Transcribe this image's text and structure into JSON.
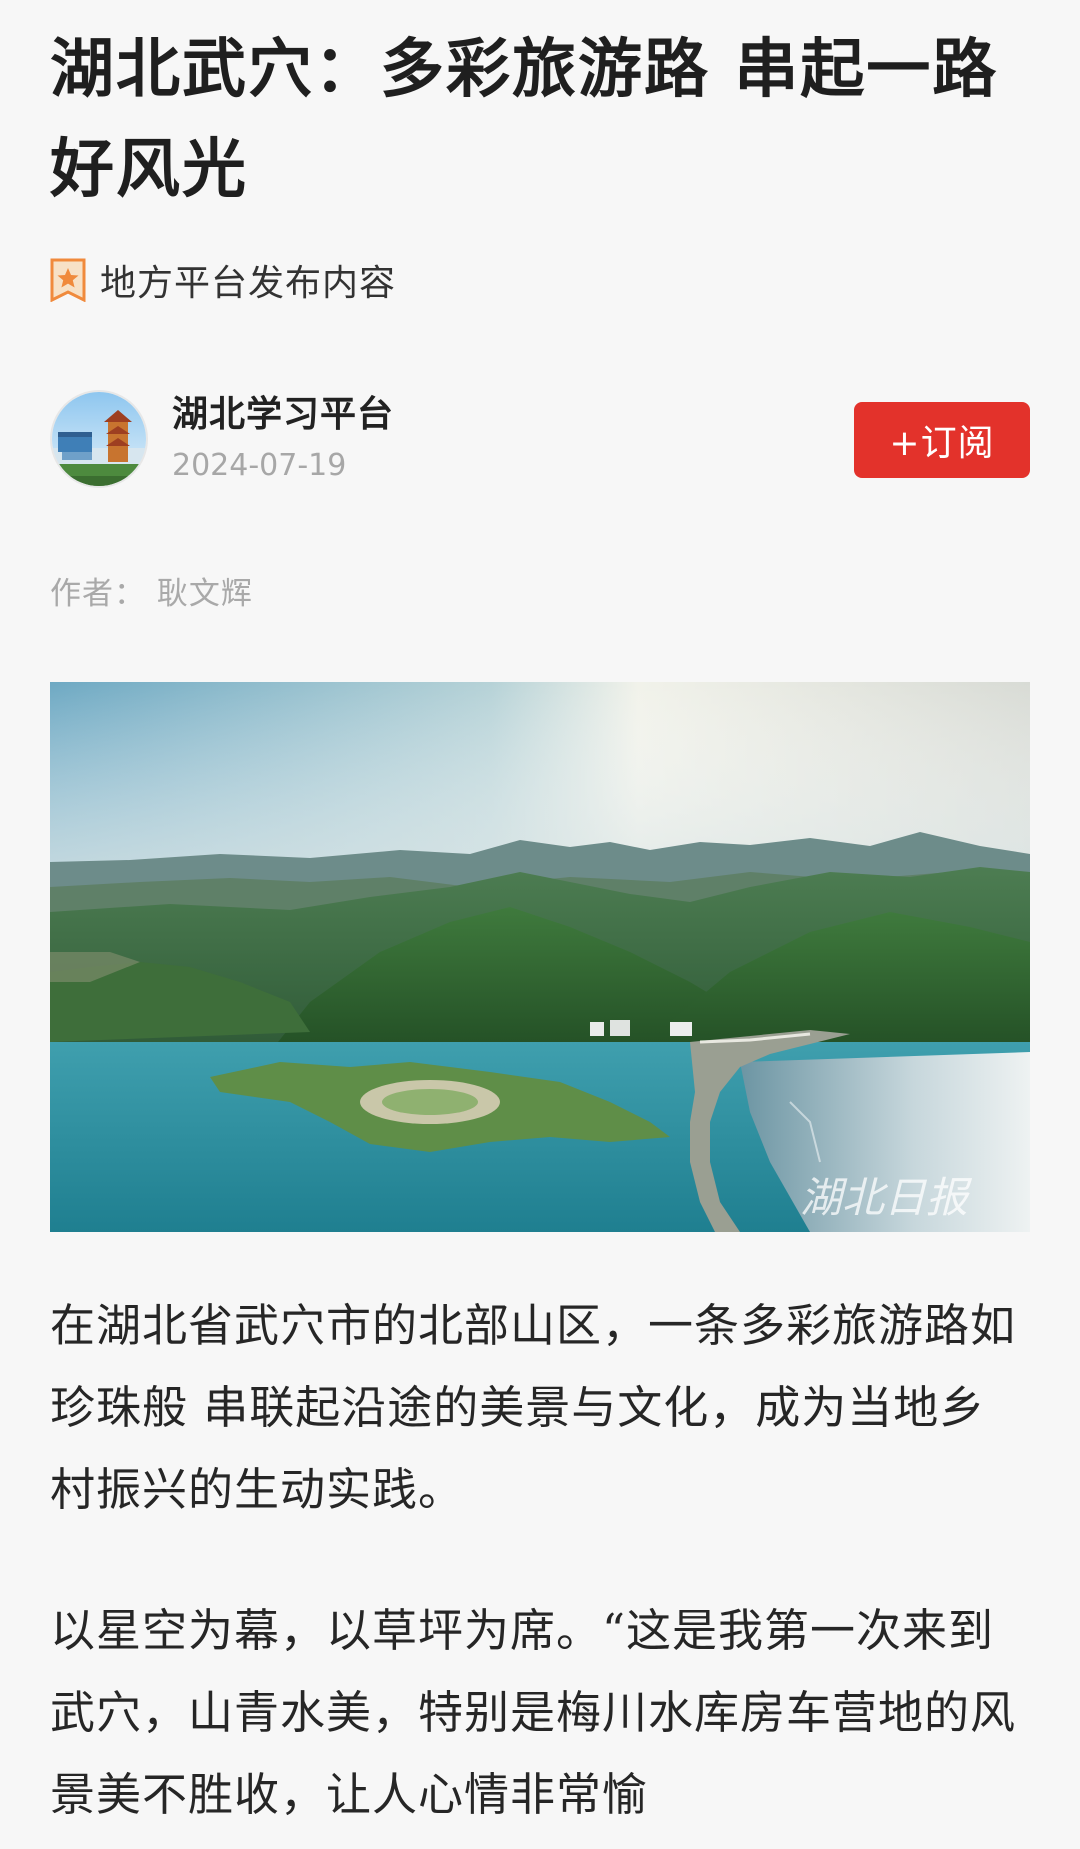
{
  "article": {
    "title": "湖北武穴：多彩旅游路  串起一路好风光",
    "source_label": "地方平台发布内容",
    "account": {
      "name": "湖北学习平台",
      "date": "2024-07-19",
      "subscribe_label": "+订阅"
    },
    "author_line": "作者： 耿文辉",
    "image": {
      "watermark": "湖北日报"
    },
    "paragraphs": [
      "在湖北省武穴市的北部山区，一条多彩旅游路如珍珠般 串联起沿途的美景与文化，成为当地乡村振兴的生动实践。",
      "以星空为幕，以草坪为席。“这是我第一次来到武穴，山青水美，特别是梅川水库房车营地的风景美不胜收，让人心情非常愉"
    ]
  },
  "colors": {
    "accent_red": "#e3322b",
    "badge_orange": "#f08a3c",
    "text_main": "#222222",
    "text_muted": "#a7a7a7",
    "background": "#f7f7f7"
  },
  "icons": {
    "source_badge": "star-badge-icon"
  }
}
